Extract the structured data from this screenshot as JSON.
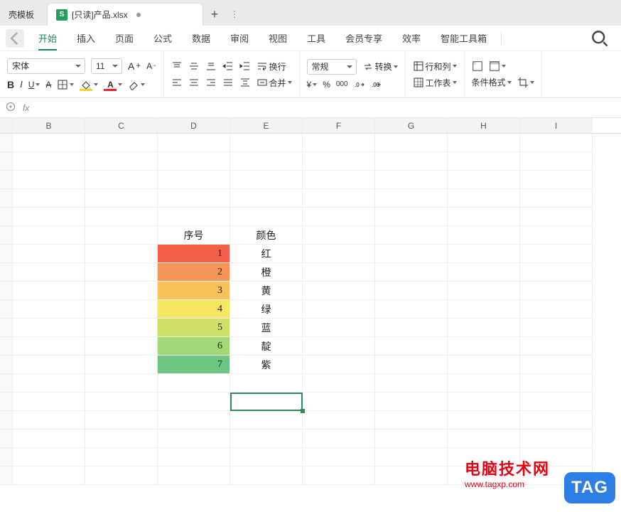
{
  "tabs": {
    "inactive_left": "壳模板",
    "active": "[只读]产品.xlsx"
  },
  "menus": [
    "开始",
    "插入",
    "页面",
    "公式",
    "数据",
    "审阅",
    "视图",
    "工具",
    "会员专享",
    "效率",
    "智能工具箱"
  ],
  "active_menu_index": 0,
  "font": {
    "name": "宋体",
    "size": "11",
    "incA": "A",
    "decA": "A"
  },
  "align": {
    "wrap": "换行",
    "merge": "合并"
  },
  "number": {
    "format": "常规",
    "convert": "转换"
  },
  "cells": {
    "rowcol": "行和列",
    "sheet": "工作表"
  },
  "cond": "条件格式",
  "formula_bar": {
    "fx": "fx"
  },
  "columns": [
    "",
    "B",
    "C",
    "D",
    "E",
    "F",
    "G",
    "H",
    "I"
  ],
  "table": {
    "header": {
      "seq": "序号",
      "color": "颜色"
    },
    "rows": [
      {
        "n": "1",
        "c": "红",
        "bg": "#f2604c"
      },
      {
        "n": "2",
        "c": "橙",
        "bg": "#f59457"
      },
      {
        "n": "3",
        "c": "黄",
        "bg": "#f9c15a"
      },
      {
        "n": "4",
        "c": "绿",
        "bg": "#f6e560"
      },
      {
        "n": "5",
        "c": "蓝",
        "bg": "#cfdf6a"
      },
      {
        "n": "6",
        "c": "靛",
        "bg": "#a3d77a"
      },
      {
        "n": "7",
        "c": "紫",
        "bg": "#6ec682"
      }
    ]
  },
  "watermark": {
    "line1": "电脑技术网",
    "line2": "www.tagxp.com",
    "badge": "TAG"
  },
  "chart_data": {}
}
